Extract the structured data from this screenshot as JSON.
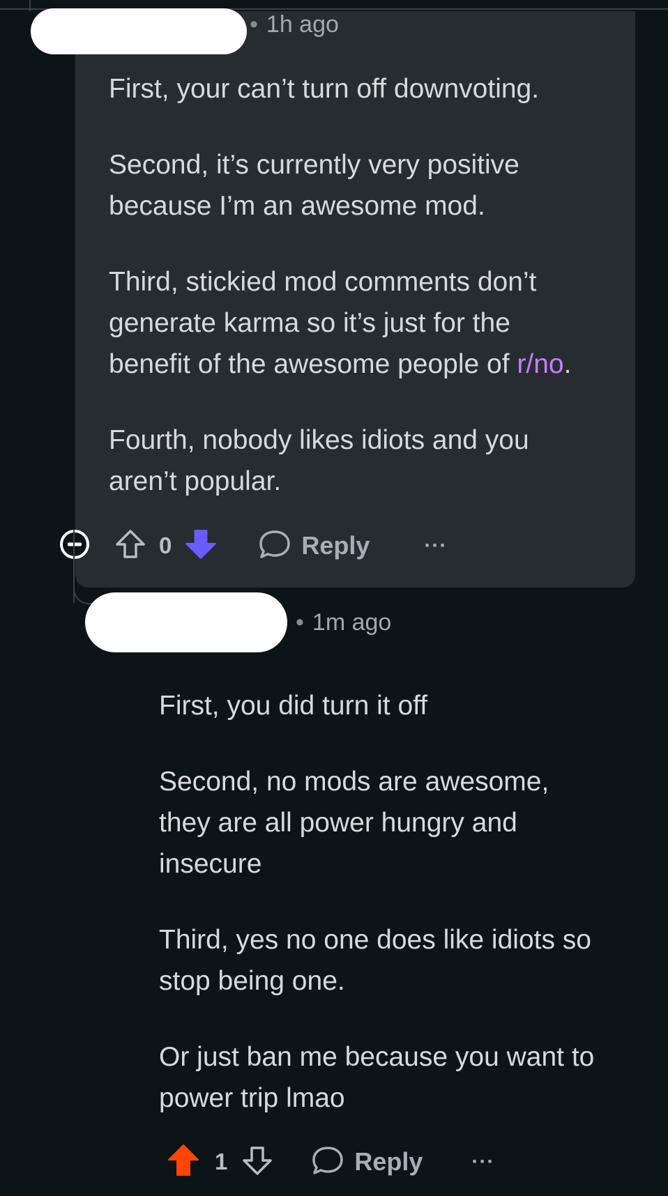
{
  "comments": [
    {
      "time": "1h ago",
      "paragraphs": [
        [
          "First, your can’t turn off downvoting."
        ],
        [
          "Second, it’s currently very positive",
          "because I’m an awesome mod."
        ],
        [
          "Third, stickied mod comments don’t",
          "generate karma so it’s just for the"
        ],
        [
          "Fourth, nobody likes idiots and you",
          "aren’t popular."
        ]
      ],
      "last_line_prefix": "benefit of the awesome people of ",
      "link_text": "r/no",
      "last_line_suffix": ".",
      "score": "0",
      "vote_state": "downvoted",
      "reply_label": "Reply",
      "more_label": "···"
    },
    {
      "time": "1m ago",
      "paragraphs": [
        [
          "First, you did turn it off"
        ],
        [
          "Second, no mods are awesome,",
          "they are all power hungry and",
          "insecure"
        ],
        [
          "Third, yes no one does like idiots so",
          "stop being one."
        ],
        [
          "Or just ban me because you want to",
          "power trip lmao"
        ]
      ],
      "score": "1",
      "vote_state": "upvoted",
      "reply_label": "Reply",
      "more_label": "···"
    }
  ],
  "colors": {
    "background": "#0d1418",
    "card": "#272c31",
    "downvote_active": "#6a5cff",
    "upvote_active": "#ff4500",
    "link": "#c77dff"
  },
  "icons": {
    "collapse": "collapse-icon",
    "upvote": "upvote-arrow-icon",
    "downvote": "downvote-arrow-icon",
    "reply": "speech-bubble-icon"
  }
}
